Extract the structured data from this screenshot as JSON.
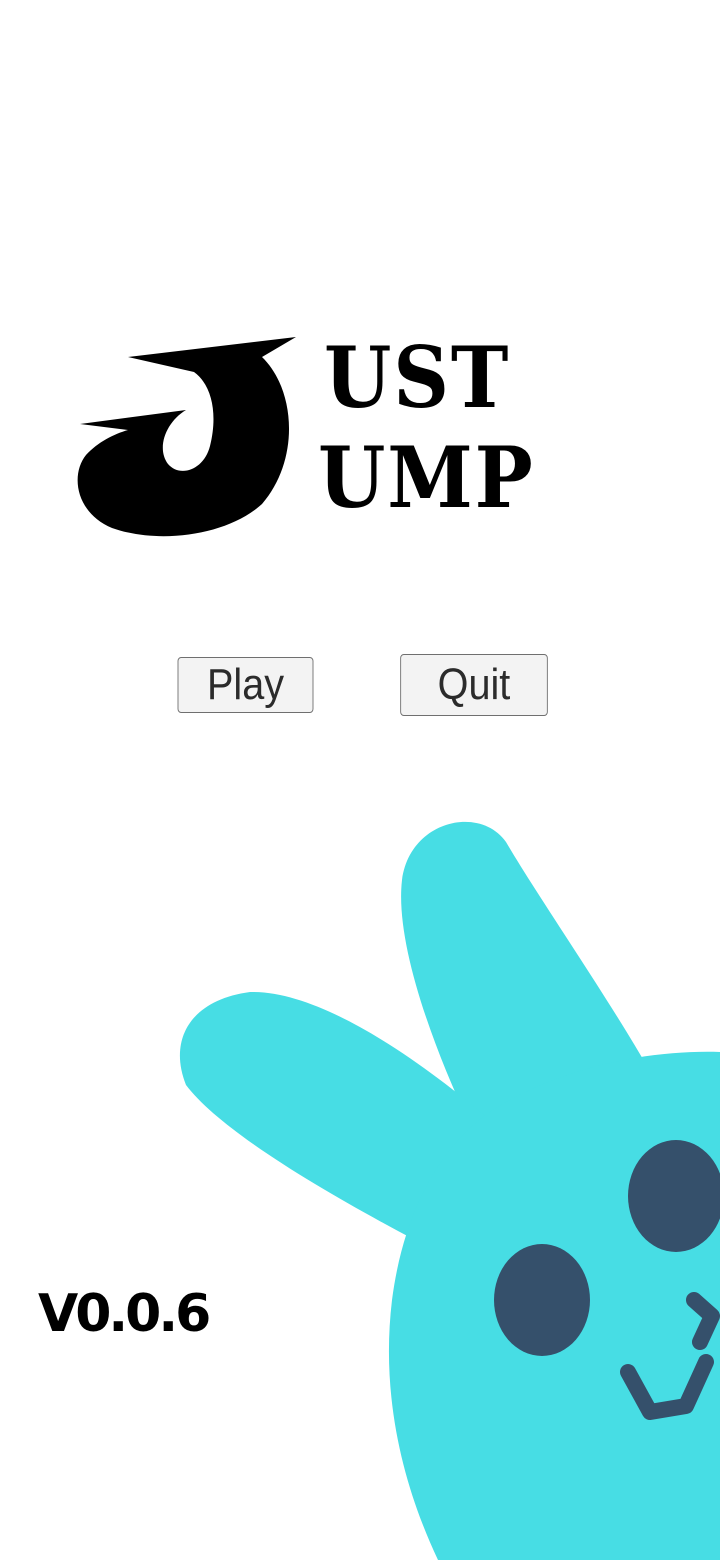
{
  "logo": {
    "line1": "UST",
    "line2": "UMP",
    "glyph_icon": "j-hook-logo-icon"
  },
  "menu": {
    "play_label": "Play",
    "quit_label": "Quit"
  },
  "version": "V0.0.6",
  "mascot": {
    "icon": "bunny-mascot-icon",
    "body_color": "#47dde4",
    "feature_color": "#35506b"
  },
  "colors": {
    "background": "#ffffff",
    "button_fill": "#f3f3f3",
    "text": "#000000"
  }
}
